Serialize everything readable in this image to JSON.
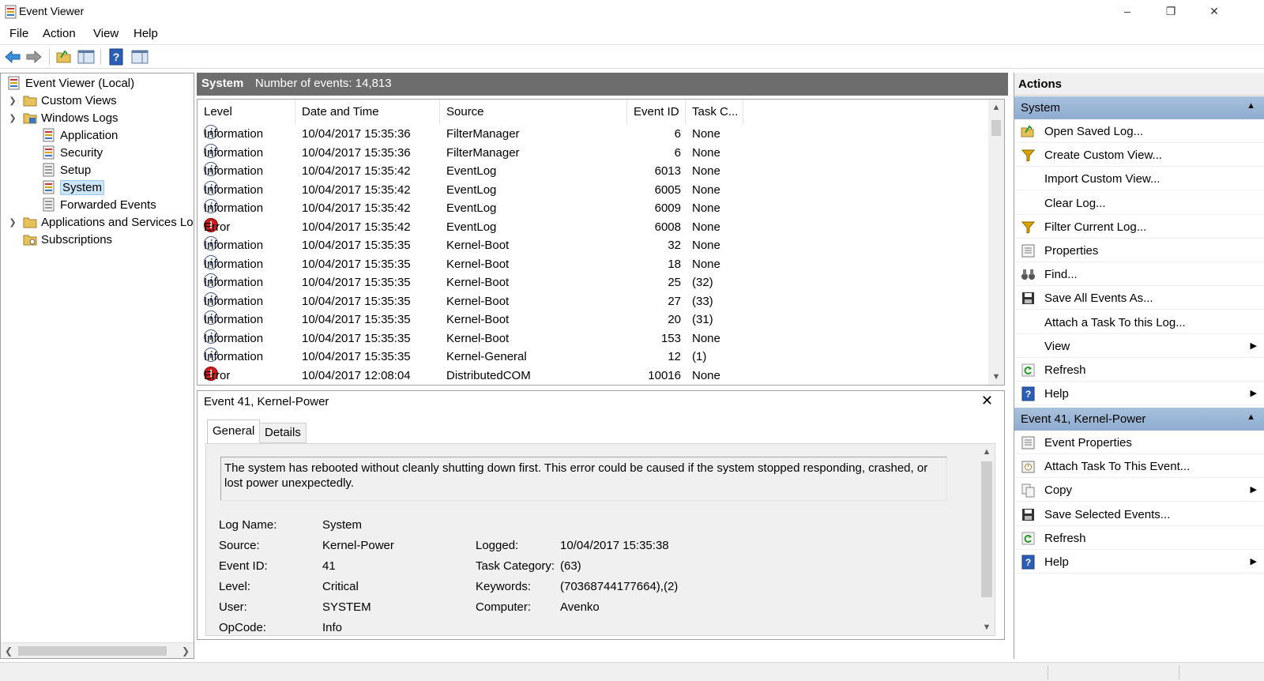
{
  "window": {
    "title": "Event Viewer",
    "minimize": "–",
    "maximize": "❐",
    "close": "✕"
  },
  "menu": {
    "file": "File",
    "action": "Action",
    "view": "View",
    "help": "Help"
  },
  "tree": {
    "root": "Event Viewer (Local)",
    "custom_views": "Custom Views",
    "windows_logs": "Windows Logs",
    "application": "Application",
    "security": "Security",
    "setup": "Setup",
    "system": "System",
    "forwarded": "Forwarded Events",
    "apps_services": "Applications and Services Lo",
    "subscriptions": "Subscriptions"
  },
  "center": {
    "title": "System",
    "count": "Number of events: 14,813"
  },
  "columns": {
    "level": "Level",
    "date": "Date and Time",
    "source": "Source",
    "event_id": "Event ID",
    "task": "Task C..."
  },
  "events": [
    {
      "level": "Information",
      "kind": "info",
      "date": "10/04/2017 15:35:36",
      "source": "FilterManager",
      "id": "6",
      "task": "None"
    },
    {
      "level": "Information",
      "kind": "info",
      "date": "10/04/2017 15:35:36",
      "source": "FilterManager",
      "id": "6",
      "task": "None"
    },
    {
      "level": "Information",
      "kind": "info",
      "date": "10/04/2017 15:35:42",
      "source": "EventLog",
      "id": "6013",
      "task": "None"
    },
    {
      "level": "Information",
      "kind": "info",
      "date": "10/04/2017 15:35:42",
      "source": "EventLog",
      "id": "6005",
      "task": "None"
    },
    {
      "level": "Information",
      "kind": "info",
      "date": "10/04/2017 15:35:42",
      "source": "EventLog",
      "id": "6009",
      "task": "None"
    },
    {
      "level": "Error",
      "kind": "error",
      "date": "10/04/2017 15:35:42",
      "source": "EventLog",
      "id": "6008",
      "task": "None"
    },
    {
      "level": "Information",
      "kind": "info",
      "date": "10/04/2017 15:35:35",
      "source": "Kernel-Boot",
      "id": "32",
      "task": "None"
    },
    {
      "level": "Information",
      "kind": "info",
      "date": "10/04/2017 15:35:35",
      "source": "Kernel-Boot",
      "id": "18",
      "task": "None"
    },
    {
      "level": "Information",
      "kind": "info",
      "date": "10/04/2017 15:35:35",
      "source": "Kernel-Boot",
      "id": "25",
      "task": "(32)"
    },
    {
      "level": "Information",
      "kind": "info",
      "date": "10/04/2017 15:35:35",
      "source": "Kernel-Boot",
      "id": "27",
      "task": "(33)"
    },
    {
      "level": "Information",
      "kind": "info",
      "date": "10/04/2017 15:35:35",
      "source": "Kernel-Boot",
      "id": "20",
      "task": "(31)"
    },
    {
      "level": "Information",
      "kind": "info",
      "date": "10/04/2017 15:35:35",
      "source": "Kernel-Boot",
      "id": "153",
      "task": "None"
    },
    {
      "level": "Information",
      "kind": "info",
      "date": "10/04/2017 15:35:35",
      "source": "Kernel-General",
      "id": "12",
      "task": "(1)"
    },
    {
      "level": "Error",
      "kind": "error",
      "date": "10/04/2017 12:08:04",
      "source": "DistributedCOM",
      "id": "10016",
      "task": "None"
    }
  ],
  "detail": {
    "title": "Event 41, Kernel-Power",
    "tab_general": "General",
    "tab_details": "Details",
    "description": "The system has rebooted without cleanly shutting down first. This error could be caused if the system stopped responding, crashed, or lost power unexpectedly.",
    "labels": {
      "log_name": "Log Name:",
      "source": "Source:",
      "event_id": "Event ID:",
      "level": "Level:",
      "user": "User:",
      "opcode": "OpCode:",
      "logged": "Logged:",
      "task_category": "Task Category:",
      "keywords": "Keywords:",
      "computer": "Computer:"
    },
    "values": {
      "log_name": "System",
      "source": "Kernel-Power",
      "event_id": "41",
      "level": "Critical",
      "user": "SYSTEM",
      "opcode": "Info",
      "logged": "10/04/2017 15:35:38",
      "task_category": "(63)",
      "keywords": "(70368744177664),(2)",
      "computer": "Avenko"
    }
  },
  "actions": {
    "header": "Actions",
    "section1": "System",
    "items1": [
      {
        "label": "Open Saved Log...",
        "icon": "folder-open-icon"
      },
      {
        "label": "Create Custom View...",
        "icon": "filter-icon"
      },
      {
        "label": "Import Custom View...",
        "icon": ""
      },
      {
        "label": "Clear Log...",
        "icon": ""
      },
      {
        "label": "Filter Current Log...",
        "icon": "filter-icon"
      },
      {
        "label": "Properties",
        "icon": "properties-icon"
      },
      {
        "label": "Find...",
        "icon": "binoculars-icon"
      },
      {
        "label": "Save All Events As...",
        "icon": "save-icon"
      },
      {
        "label": "Attach a Task To this Log...",
        "icon": ""
      },
      {
        "label": "View",
        "icon": "",
        "submenu": true
      },
      {
        "label": "Refresh",
        "icon": "refresh-icon"
      },
      {
        "label": "Help",
        "icon": "help-icon",
        "submenu": true
      }
    ],
    "section2": "Event 41, Kernel-Power",
    "items2": [
      {
        "label": "Event Properties",
        "icon": "properties-icon"
      },
      {
        "label": "Attach Task To This Event...",
        "icon": "task-icon"
      },
      {
        "label": "Copy",
        "icon": "copy-icon",
        "submenu": true
      },
      {
        "label": "Save Selected Events...",
        "icon": "save-icon"
      },
      {
        "label": "Refresh",
        "icon": "refresh-icon"
      },
      {
        "label": "Help",
        "icon": "help-icon",
        "submenu": true
      }
    ]
  },
  "colors": {
    "selection": "#cce4f7",
    "header_dark": "#6d6d6d",
    "section_blue": "#8daccf",
    "error_red": "#cc1f1f",
    "info_blue": "#2f4b85"
  }
}
